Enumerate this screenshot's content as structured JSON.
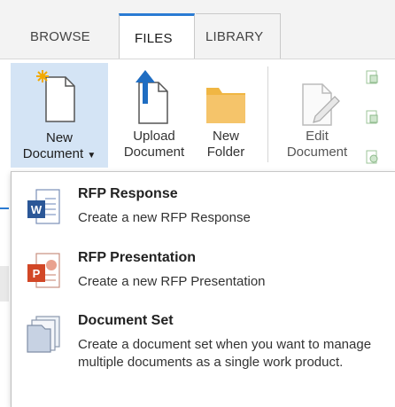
{
  "tabs": {
    "browse": "BROWSE",
    "files": "FILES",
    "library": "LIBRARY"
  },
  "ribbon": {
    "new_document": {
      "line1": "New",
      "line2": "Document"
    },
    "upload_document": {
      "line1": "Upload",
      "line2": "Document"
    },
    "new_folder": {
      "line1": "New",
      "line2": "Folder"
    },
    "edit_document": {
      "line1": "Edit",
      "line2": "Document"
    }
  },
  "menu": {
    "items": [
      {
        "title": "RFP Response",
        "description": "Create a new RFP Response",
        "icon": "word-doc-icon"
      },
      {
        "title": "RFP Presentation",
        "description": "Create a new RFP Presentation",
        "icon": "powerpoint-icon"
      },
      {
        "title": "Document Set",
        "description": "Create a document set when you want to manage multiple documents as a single work product.",
        "icon": "document-set-icon"
      }
    ]
  },
  "colors": {
    "accent": "#2a7bd3",
    "selected_bg": "#d4e4f5",
    "word_blue": "#2b5797",
    "powerpoint_red": "#d24726",
    "folder_orange": "#f0b643"
  }
}
